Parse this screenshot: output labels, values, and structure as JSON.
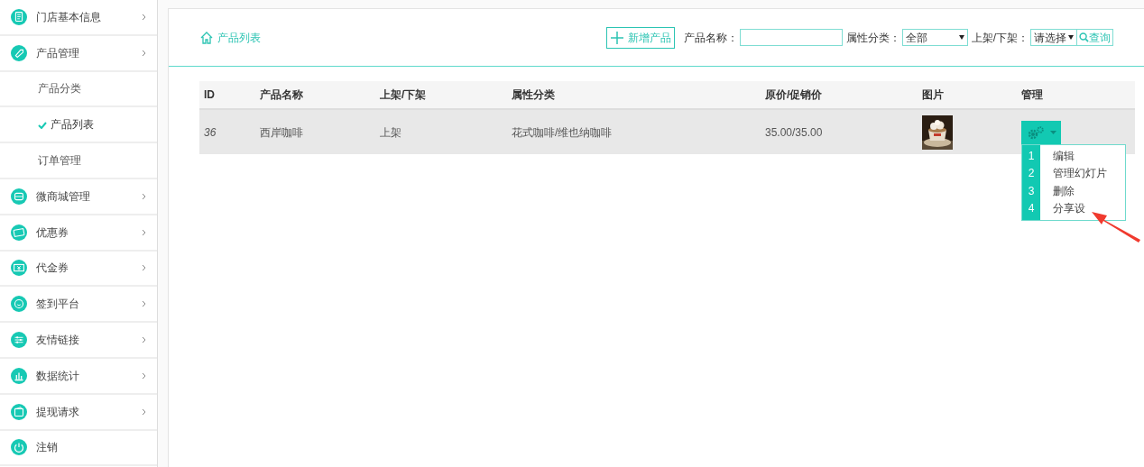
{
  "sidebar": {
    "items": [
      {
        "label": "门店基本信息",
        "submenu": true
      },
      {
        "label": "产品管理",
        "submenu": true,
        "children": [
          {
            "label": "产品分类",
            "selected": false
          },
          {
            "label": "产品列表",
            "selected": true
          },
          {
            "label": "订单管理",
            "selected": false
          }
        ]
      },
      {
        "label": "微商城管理",
        "submenu": true
      },
      {
        "label": "优惠券",
        "submenu": true
      },
      {
        "label": "代金券",
        "submenu": true
      },
      {
        "label": "签到平台",
        "submenu": true
      },
      {
        "label": "友情链接",
        "submenu": true
      },
      {
        "label": "数据统计",
        "submenu": true
      },
      {
        "label": "提现请求",
        "submenu": true
      },
      {
        "label": "注销",
        "submenu": false
      }
    ]
  },
  "breadcrumb": {
    "label": "产品列表"
  },
  "toolbar": {
    "add_button": "新增产品",
    "filters": [
      {
        "kind": "input",
        "label": "产品名称："
      },
      {
        "kind": "select",
        "label": "属性分类：",
        "value": "全部"
      },
      {
        "kind": "select",
        "label": "上架/下架：",
        "value": "请选择"
      }
    ],
    "search_button": "查询"
  },
  "table": {
    "columns": [
      "ID",
      "产品名称",
      "上架/下架",
      "属性分类",
      "原价/促销价",
      "图片",
      "管理"
    ],
    "rows": [
      {
        "id": "36",
        "name": "西岸咖啡",
        "status": "上架",
        "category": "花式咖啡/维也纳咖啡",
        "price": "35.00/35.00"
      }
    ]
  },
  "action_menu": {
    "items": [
      {
        "number": "1",
        "label": "编辑"
      },
      {
        "number": "2",
        "label": "管理幻灯片"
      },
      {
        "number": "3",
        "label": "删除"
      },
      {
        "number": "4",
        "label": "分享设"
      }
    ]
  }
}
